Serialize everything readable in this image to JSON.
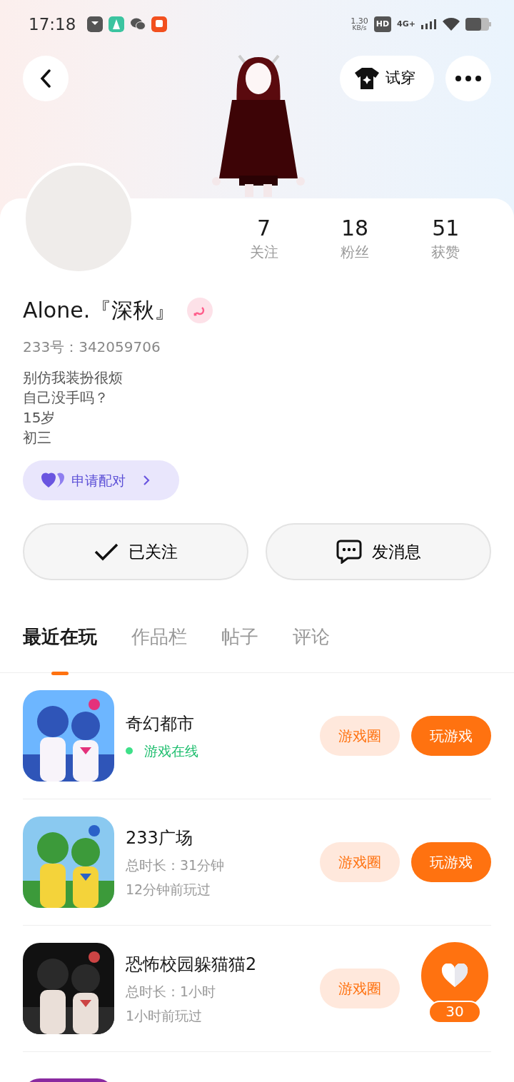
{
  "status_bar": {
    "time": "17:18",
    "net_speed": "1.30",
    "net_unit": "KB/s",
    "hd": "HD",
    "network": "4G+"
  },
  "header": {
    "try_on_label": "试穿"
  },
  "profile": {
    "stats": [
      {
        "value": "7",
        "label": "关注"
      },
      {
        "value": "18",
        "label": "粉丝"
      },
      {
        "value": "51",
        "label": "获赞"
      }
    ],
    "name": "Alone.『深秋』",
    "gender": {
      "kind": "female"
    },
    "id_text": "233号：342059706",
    "bio": [
      "别仿我装扮很烦",
      "自己没手吗？",
      "15岁",
      "初三"
    ],
    "pair_label": "申请配对",
    "follow_label": "已关注",
    "followed": true,
    "message_label": "发消息"
  },
  "tabs": [
    {
      "label": "最近在玩",
      "selected": true
    },
    {
      "label": "作品栏",
      "selected": false
    },
    {
      "label": "帖子",
      "selected": false
    },
    {
      "label": "评论",
      "selected": false
    }
  ],
  "games": [
    {
      "title": "奇幻都市",
      "online": "游戏在线",
      "circle_label": "游戏圈",
      "play_label": "玩游戏"
    },
    {
      "title": "233广场",
      "duration": "总时长：31分钟",
      "last_played": "12分钟前玩过",
      "circle_label": "游戏圈",
      "play_label": "玩游戏"
    },
    {
      "title": "恐怖校园躲猫猫2",
      "duration": "总时长：1小时",
      "last_played": "1小时前玩过",
      "circle_label": "游戏圈"
    },
    {
      "kind": "picture"
    }
  ],
  "like_fab": {
    "count": "30"
  }
}
